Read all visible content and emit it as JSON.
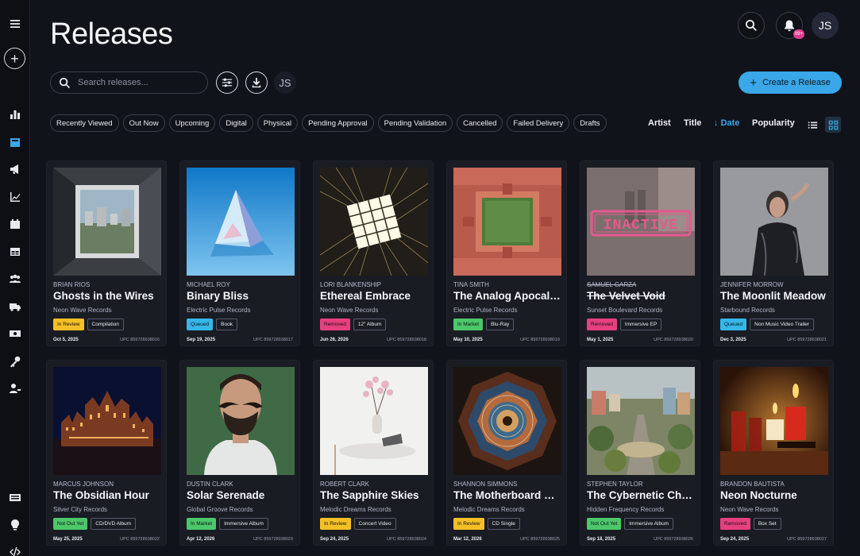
{
  "app": {
    "title": "Releases"
  },
  "user": {
    "initials": "JS"
  },
  "notifications": {
    "badge": "99+"
  },
  "search": {
    "placeholder": "Search releases..."
  },
  "actions": {
    "create_label": "Create a Release"
  },
  "filters": [
    "Recently Viewed",
    "Out Now",
    "Upcoming",
    "Digital",
    "Physical",
    "Pending Approval",
    "Pending Validation",
    "Cancelled",
    "Failed Delivery",
    "Drafts"
  ],
  "sort": {
    "artist": "Artist",
    "title": "Title",
    "date": "Date",
    "popularity": "Popularity",
    "active": "date"
  },
  "status_colors": {
    "In Review": "#f5c026",
    "Queued": "#35b7e8",
    "Removed": "#e8407f",
    "In Market": "#4cc76a",
    "Not Out Yet": "#4cc76a"
  },
  "accent_color": "#3aa7e8",
  "releases": [
    {
      "artist": "BRIAN RIOS",
      "title": "Ghosts in the Wires",
      "label": "Neon Wave Records",
      "status": "In Review",
      "format": "Compilation",
      "date": "Oct 5, 2025",
      "upc": "UPC 859728938016",
      "inactive": false
    },
    {
      "artist": "MICHAEL ROY",
      "title": "Binary Bliss",
      "label": "Electric Pulse Records",
      "status": "Queued",
      "format": "Book",
      "date": "Sep 19, 2025",
      "upc": "UPC 859728938017",
      "inactive": false
    },
    {
      "artist": "LORI BLANKENSHIP",
      "title": "Ethereal Embrace",
      "label": "Neon Wave Records",
      "status": "Removed",
      "format": "12\" Album",
      "date": "Jun 26, 2026",
      "upc": "UPC 859728938018",
      "inactive": false
    },
    {
      "artist": "TINA SMITH",
      "title": "The Analog Apocalypse",
      "label": "Electric Pulse Records",
      "status": "In Market",
      "format": "Blu-Ray",
      "date": "May 10, 2025",
      "upc": "UPC 859728938019",
      "inactive": false
    },
    {
      "artist": "SAMUEL GARZA",
      "title": "The Velvet Void",
      "label": "Sunset Boulevard Records",
      "status": "Removed",
      "format": "Immersive EP",
      "date": "May 1, 2025",
      "upc": "UPC 859728938020",
      "inactive": true,
      "stamp": "INACTIVE"
    },
    {
      "artist": "JENNIFER MORROW",
      "title": "The Moonlit Meadow",
      "label": "Starbound Records",
      "status": "Queued",
      "format": "Non Music Video Trailer",
      "date": "Dec 3, 2025",
      "upc": "UPC 859728938021",
      "inactive": false
    },
    {
      "artist": "MARCUS JOHNSON",
      "title": "The Obsidian Hour",
      "label": "Silver City Records",
      "status": "Not Out Yet",
      "format": "CD/DVD Album",
      "date": "May 25, 2025",
      "upc": "UPC 859728938022",
      "inactive": false
    },
    {
      "artist": "DUSTIN CLARK",
      "title": "Solar Serenade",
      "label": "Global Groove Records",
      "status": "In Market",
      "format": "Immersive Album",
      "date": "Apr 12, 2026",
      "upc": "UPC 859728938023",
      "inactive": false
    },
    {
      "artist": "ROBERT CLARK",
      "title": "The Sapphire Skies",
      "label": "Melodic Dreams Records",
      "status": "In Review",
      "format": "Concert Video",
      "date": "Sep 24, 2025",
      "upc": "UPC 859728938024",
      "inactive": false
    },
    {
      "artist": "SHANNON SIMMONS",
      "title": "The Motherboard Matrix",
      "label": "Melodic Dreams Records",
      "status": "In Review",
      "format": "CD Single",
      "date": "Mar 12, 2026",
      "upc": "UPC 859728938025",
      "inactive": false
    },
    {
      "artist": "STEPHEN TAYLOR",
      "title": "The Cybernetic Chronicles",
      "label": "Hidden Frequency Records",
      "status": "Not Out Yet",
      "format": "Immersive Album",
      "date": "Sep 18, 2025",
      "upc": "UPC 859728938026",
      "inactive": false
    },
    {
      "artist": "BRANDON BAUTISTA",
      "title": "Neon Nocturne",
      "label": "Neon Wave Records",
      "status": "Removed",
      "format": "Box Set",
      "date": "Sep 24, 2025",
      "upc": "UPC 859728938027",
      "inactive": false
    }
  ]
}
